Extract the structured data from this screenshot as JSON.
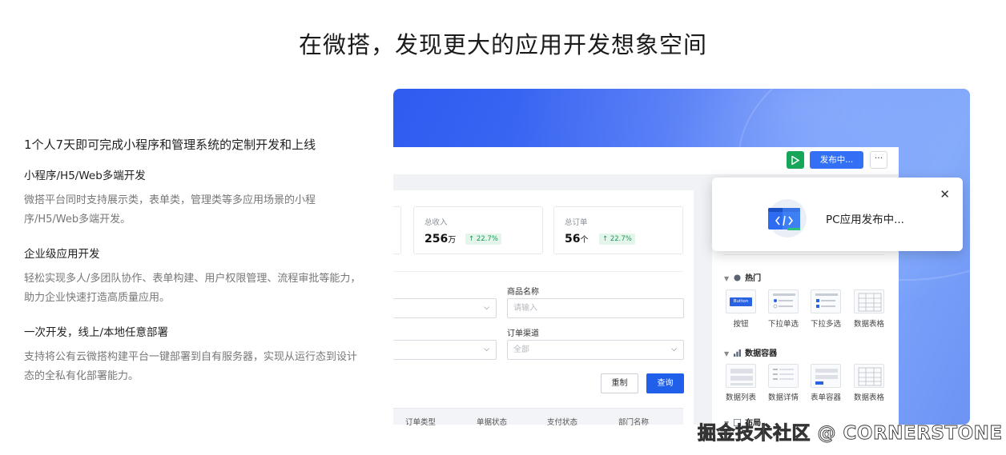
{
  "headline": "在微搭，发现更大的应用开发想象空间",
  "intro": {
    "subtitle": "1个人7天即可完成小程序和管理系统的定制开发和上线",
    "features": [
      {
        "title": "小程序/H5/Web多端开发",
        "desc": "微搭平台同时支持展示类，表单类，管理类等多应用场景的小程序/H5/Web多端开发。"
      },
      {
        "title": "企业级应用开发",
        "desc": "轻松实现多人/多团队协作、表单构建、用户权限管理、流程审批等能力，助力企业快速打造高质量应用。"
      },
      {
        "title": "一次开发，线上/本地任意部署",
        "desc": "支持将公有云微搭构建平台一键部署到自有服务器，实现从运行态到设计态的全私有化部署能力。"
      }
    ]
  },
  "editor": {
    "toolbar": {
      "publish_label": "发布中...",
      "more_label": "···"
    },
    "stats": [
      {
        "label": "总收入",
        "value": "256",
        "unit": "万",
        "change": "↑ 22.7%"
      },
      {
        "label": "总订单",
        "value": "56",
        "unit": "个",
        "change": "↑ 22.7%"
      }
    ],
    "form": {
      "product_name_label": "商品名称",
      "product_name_placeholder": "请输入",
      "order_channel_label": "订单渠道",
      "order_channel_value": "全部",
      "reset_label": "重制",
      "query_label": "查询"
    },
    "table_headers": [
      "订单类型",
      "单据状态",
      "支付状态",
      "部门名称"
    ],
    "panel": {
      "sections": [
        {
          "title": "热门",
          "items": [
            "按钮",
            "下拉单选",
            "下拉多选",
            "数据表格"
          ],
          "button_text": "Button"
        },
        {
          "title": "数据容器",
          "items": [
            "数据列表",
            "数据详情",
            "表单容器",
            "数据表格"
          ]
        },
        {
          "title": "布局"
        }
      ]
    },
    "toast": {
      "message": "PC应用发布中...",
      "close_label": "✕"
    }
  },
  "watermark": "掘金技术社区 @ CORNERSTONE",
  "colors": {
    "accent": "#1f5fe9",
    "play": "#17a55a",
    "positive": "#1a9a55"
  }
}
